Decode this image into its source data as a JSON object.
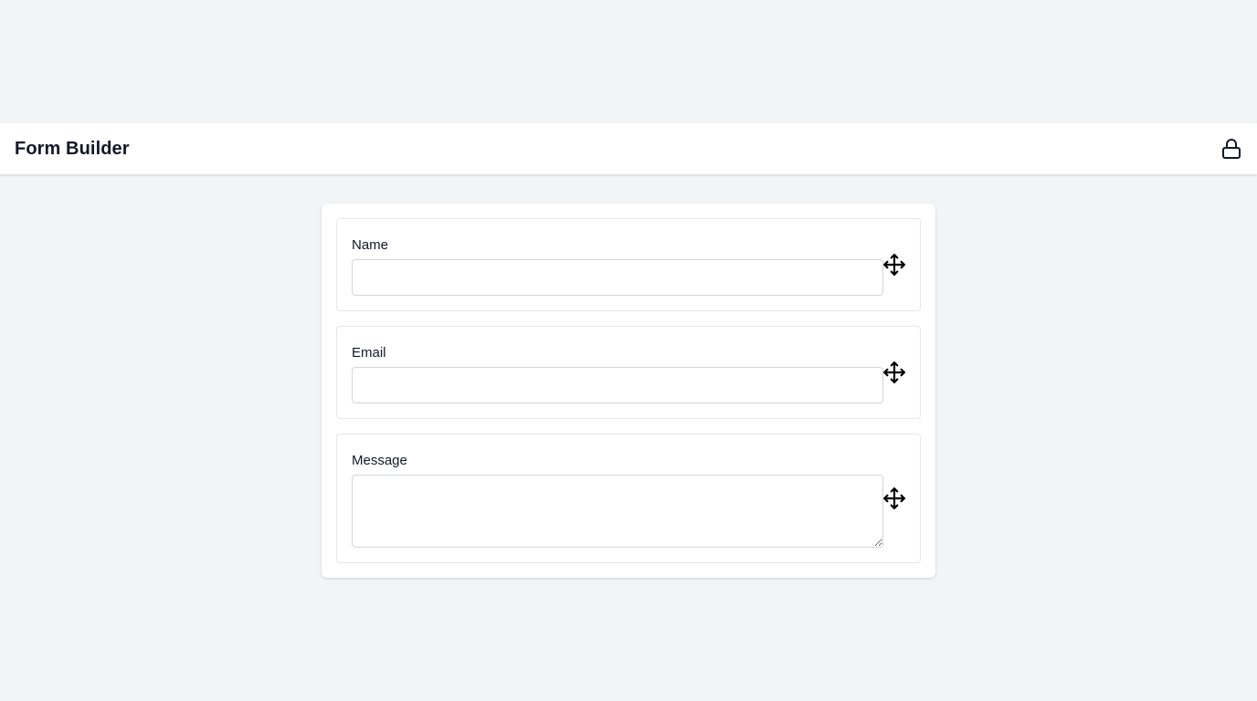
{
  "header": {
    "title": "Form Builder",
    "lock_icon": "lock-icon"
  },
  "form": {
    "fields": [
      {
        "label": "Name",
        "type": "text",
        "value": "",
        "handle_icon": "move-icon"
      },
      {
        "label": "Email",
        "type": "text",
        "value": "",
        "handle_icon": "move-icon"
      },
      {
        "label": "Message",
        "type": "textarea",
        "value": "",
        "handle_icon": "move-icon"
      }
    ]
  },
  "colors": {
    "page_background": "#f3f4f6",
    "surface": "#ffffff",
    "text": "#111827",
    "border": "#e5e7eb",
    "input_border": "#d1d5db"
  }
}
